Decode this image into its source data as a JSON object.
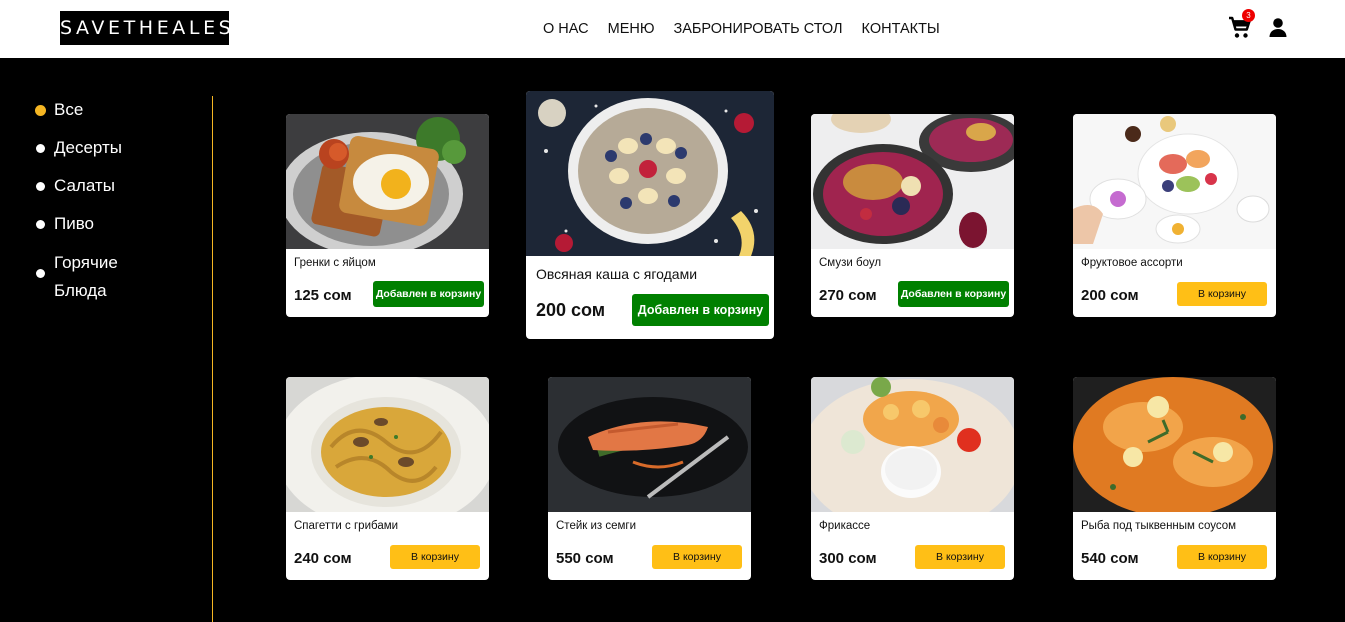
{
  "header": {
    "logo": "SAVETHEALES",
    "nav": [
      "О НАС",
      "МЕНЮ",
      "ЗАБРОНИРОВАТЬ СТОЛ",
      "КОНТАКТЫ"
    ],
    "cart_count": "3"
  },
  "sidebar": {
    "categories": [
      "Все",
      "Десерты",
      "Салаты",
      "Пиво",
      "Горячие\nБлюда"
    ],
    "active_index": 0
  },
  "products": [
    {
      "name": "Гренки с яйцом",
      "price": "125 сом",
      "button": "Добавлен в корзину",
      "in_cart": true
    },
    {
      "name": "Овсяная каша с ягодами",
      "price": "200 сом",
      "button": "Добавлен в корзину",
      "in_cart": true
    },
    {
      "name": "Смузи боул",
      "price": "270 сом",
      "button": "Добавлен в корзину",
      "in_cart": true
    },
    {
      "name": "Фруктовое ассорти",
      "price": "200 сом",
      "button": "В корзину",
      "in_cart": false
    },
    {
      "name": "Спагетти с грибами",
      "price": "240 сом",
      "button": "В корзину",
      "in_cart": false
    },
    {
      "name": "Стейк из семги",
      "price": "550 сом",
      "button": "В корзину",
      "in_cart": false
    },
    {
      "name": "Фрикассе",
      "price": "300 сом",
      "button": "В корзину",
      "in_cart": false
    },
    {
      "name": "Рыба под тыквенным соусом",
      "price": "540 сом",
      "button": "В корзину",
      "in_cart": false
    }
  ],
  "colors": {
    "accent": "#f5b623",
    "added_button": "#008000",
    "cart_button": "#ffbf16",
    "badge": "#e00000",
    "background": "#000000"
  }
}
